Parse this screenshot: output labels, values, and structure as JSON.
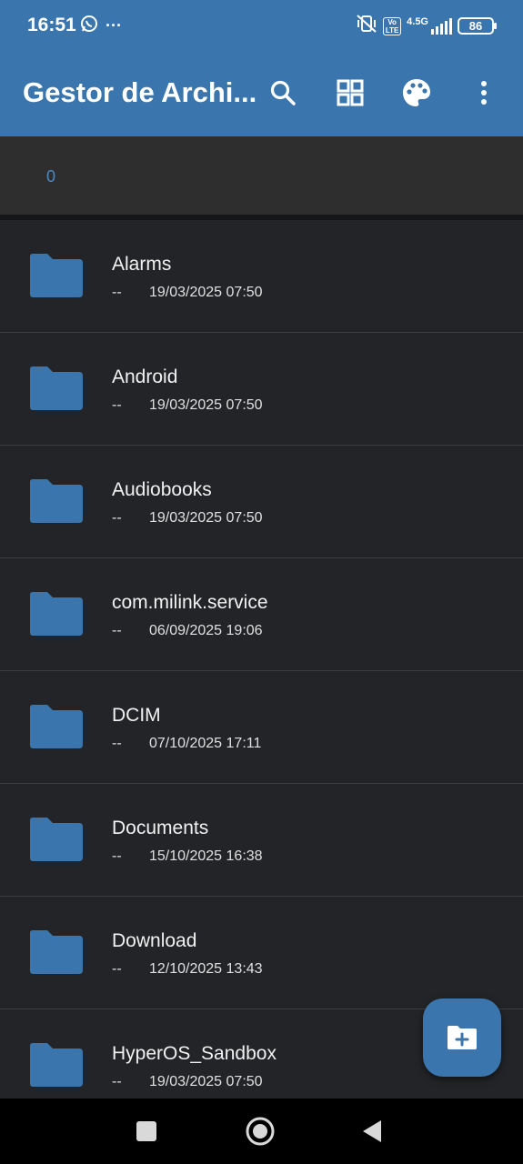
{
  "status_bar": {
    "time": "16:51",
    "overflow": "···",
    "network": "4.5G",
    "volte": "Vo LTE",
    "battery": "86",
    "icons": [
      "whatsapp-icon",
      "vibrate-off-icon",
      "signal-icon"
    ]
  },
  "app_bar": {
    "title": "Gestor de Archi...",
    "actions": [
      "search-icon",
      "grid-view-icon",
      "palette-icon",
      "more-vert-icon"
    ]
  },
  "breadcrumb": {
    "path": "0"
  },
  "files": [
    {
      "name": "Alarms",
      "size": "--",
      "date": "19/03/2025 07:50"
    },
    {
      "name": "Android",
      "size": "--",
      "date": "19/03/2025 07:50"
    },
    {
      "name": "Audiobooks",
      "size": "--",
      "date": "19/03/2025 07:50"
    },
    {
      "name": "com.milink.service",
      "size": "--",
      "date": "06/09/2025 19:06"
    },
    {
      "name": "DCIM",
      "size": "--",
      "date": "07/10/2025 17:11"
    },
    {
      "name": "Documents",
      "size": "--",
      "date": "15/10/2025 16:38"
    },
    {
      "name": "Download",
      "size": "--",
      "date": "12/10/2025 13:43"
    },
    {
      "name": "HyperOS_Sandbox",
      "size": "--",
      "date": "19/03/2025 07:50"
    }
  ],
  "fab": {
    "icon": "create-folder-icon"
  },
  "nav_bar": {
    "buttons": [
      "recents-icon",
      "home-icon",
      "back-icon"
    ]
  },
  "colors": {
    "primary": "#3a76ad",
    "background": "#232427",
    "path_bar": "#2e2e2e",
    "breadcrumb_text": "#4a8ac7",
    "folder": "#3a76ad"
  }
}
